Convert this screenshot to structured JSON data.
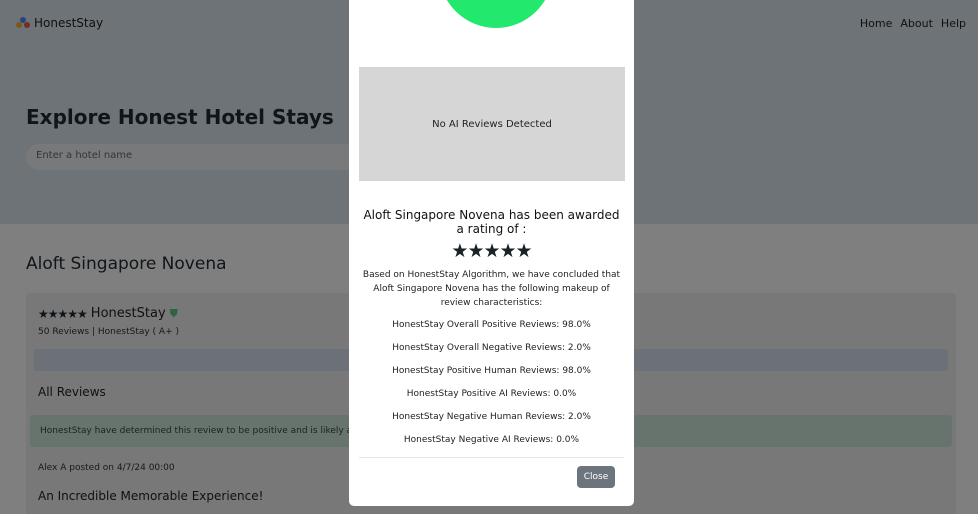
{
  "navbar": {
    "brand": "HonestStay",
    "links": [
      "Home",
      "About",
      "Help"
    ]
  },
  "hero": {
    "title": "Explore Honest Hotel Stays",
    "search_placeholder": "Enter a hotel name"
  },
  "hotel": {
    "name": "Aloft Singapore Novena",
    "stars": "★★★★★",
    "badge_label": "HonestStay",
    "reviews_summary": "50 Reviews  |  HonestStay ( A+ )",
    "all_reviews_label": "All Reviews",
    "review_banner": "HonestStay have determined this review to be positive and is likely a Huma",
    "review_posted": "Alex A posted on 4/7/24 00:00",
    "review_title": "An Incredible Memorable Experience!"
  },
  "modal": {
    "ai_detection": "No AI Reviews Detected",
    "award_text": "Aloft Singapore Novena has been awarded a rating of :",
    "rating_stars": "★★★★★",
    "description": "Based on HonestStay Algorithm, we have concluded that Aloft Singapore Novena has the following makeup of review characteristics:",
    "stats": [
      "HonestStay Overall Positive Reviews: 98.0%",
      "HonestStay Overall Negative Reviews: 2.0%",
      "HonestStay Positive Human Reviews: 98.0%",
      "HonestStay Positive AI Reviews: 0.0%",
      "HonestStay Negative Human Reviews: 2.0%",
      "HonestStay Negative AI Reviews: 0.0%"
    ],
    "close_label": "Close"
  },
  "colors": {
    "accent_green": "#22e86e",
    "close_button": "#6c757d",
    "hero_bg": "#dde6ee"
  }
}
